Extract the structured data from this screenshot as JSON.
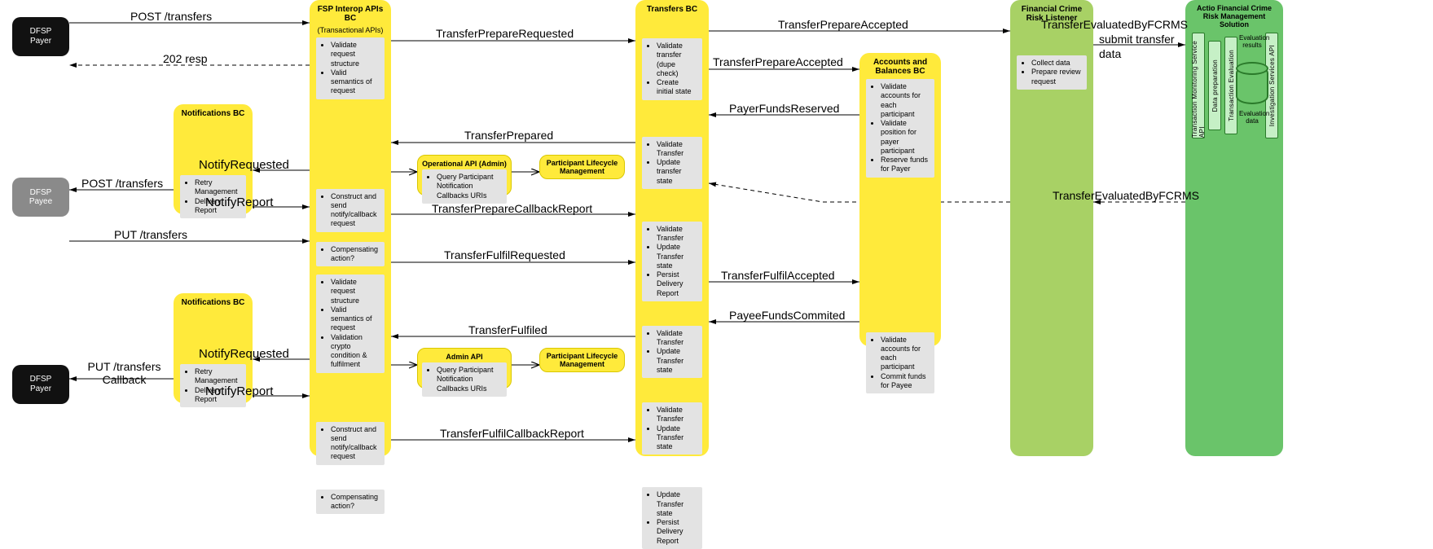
{
  "actors": {
    "payer": {
      "l1": "DFSP",
      "l2": "Payer"
    },
    "payee": {
      "l1": "DFSP",
      "l2": "Payee"
    },
    "payer2": {
      "l1": "DFSP",
      "l2": "Payer"
    }
  },
  "notif1": {
    "title": "Notifications BC",
    "items": [
      "Retry Management",
      "Delivery Report"
    ]
  },
  "notif2": {
    "title": "Notifications BC",
    "items": [
      "Retry Management",
      "Delivery Report"
    ]
  },
  "fsp": {
    "title": "FSP Interop APIs BC",
    "sub": "(Transactional APIs)",
    "n1": [
      "Validate request structure",
      "Valid semantics of request"
    ],
    "n2": [
      "Construct and send notify/callback request"
    ],
    "n3": [
      "Compensating action?"
    ],
    "n4": [
      "Validate request structure",
      "Valid semantics of request",
      "Validation crypto condition & fulfilment"
    ],
    "n5": [
      "Construct and send notify/callback request"
    ],
    "n6": [
      "Compensating action?"
    ]
  },
  "op1": {
    "title": "Operational API (Admin)",
    "items": [
      "Query Participant Notification Callbacks URIs"
    ]
  },
  "plm1": {
    "title": "Participant Lifecycle Management"
  },
  "op2": {
    "title": "Admin API",
    "items": [
      "Query Participant Notification Callbacks URIs"
    ]
  },
  "plm2": {
    "title": "Participant Lifecycle Management"
  },
  "transfers": {
    "title": "Transfers BC",
    "n1": [
      "Validate transfer (dupe check)",
      "Create initial state"
    ],
    "n2": [
      "Validate Transfer",
      "Update transfer state"
    ],
    "n3": [
      "Validate Transfer",
      "Update Transfer state",
      "Persist Delivery Report"
    ],
    "n4": [
      "Validate Transfer",
      "Update Transfer state"
    ],
    "n5": [
      "Validate Transfer",
      "Update Transfer state"
    ],
    "n6": [
      "Update Transfer state",
      "Persist Delivery Report"
    ]
  },
  "accounts": {
    "title": "Accounts and Balances BC",
    "n1": [
      "Validate accounts for each participant",
      "Validate position for payer participant",
      "Reserve funds for Payer"
    ],
    "n2": [
      "Validate accounts for each participant",
      "Commit funds for Payee"
    ]
  },
  "fcrl": {
    "title": "Financial Crime Risk Listener",
    "n1": [
      "Collect data",
      "Prepare review request"
    ]
  },
  "fcrms": {
    "title": "Actio Financial Crime Risk Management Solution",
    "boxes": [
      "Transaction Monitoring Service API",
      "Data preparation",
      "Transaction Evaluation",
      "Investigation Services API"
    ],
    "labels": [
      "Evaluation results",
      "Evaluation data"
    ]
  },
  "msgs": {
    "m_post1": "POST /transfers",
    "m_202": "202 resp",
    "m_post2": "POST /transfers",
    "m_put": "PUT /transfers",
    "m_putcb": "PUT /transfers Callback",
    "m_nreq": "NotifyRequested",
    "m_nrep": "NotifyReport",
    "m_tpr": "TransferPrepareRequested",
    "m_tp": "TransferPrepared",
    "m_tpcb": "TransferPrepareCallbackReport",
    "m_tfr": "TransferFulfilRequested",
    "m_tf": "TransferFulfiled",
    "m_tfcb": "TransferFulfilCallbackReport",
    "m_tpa": "TransferPrepareAccepted",
    "m_tpa2": "TransferPrepareAccepted",
    "m_pfr": "PayerFundsReserved",
    "m_tfa": "TransferFulfilAccepted",
    "m_pfc": "PayeeFundsCommited",
    "m_tef": "TransferEvaluatedByFCRMS",
    "m_tef2": "TransferEvaluatedByFCRMS",
    "m_sub1": "submit transfer",
    "m_sub2": "data"
  }
}
